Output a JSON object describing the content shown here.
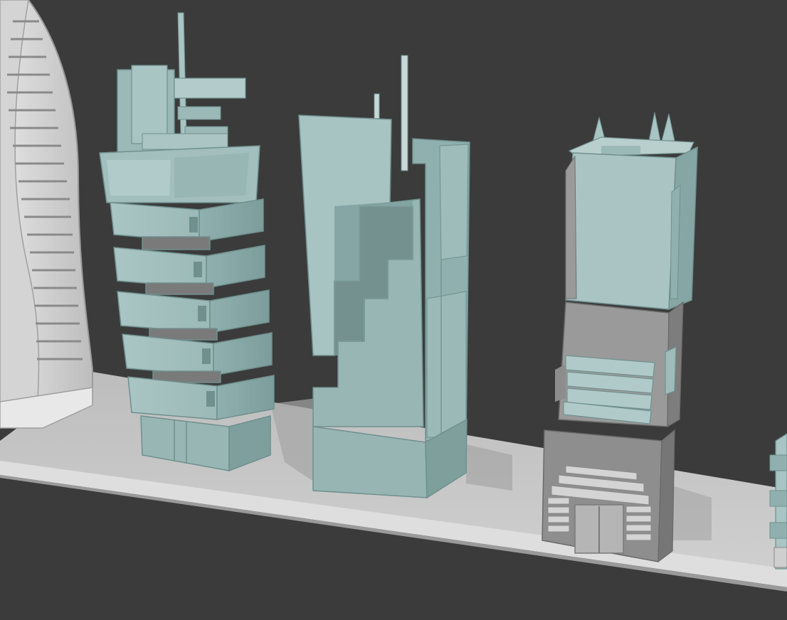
{
  "scene": {
    "colors": {
      "background": "#3b3b3b",
      "ground_top": "#c9c9c9",
      "ground_front": "#d9d9d9",
      "ground_shadow": "#8d8d8d",
      "teal_light": "#a8c4c3",
      "teal_mid": "#8fb0ae",
      "teal_dark": "#6f908e",
      "glass": "#7fa19f",
      "gray_light": "#cfcfcf",
      "gray_mid": "#9a9a9a",
      "gray_dark": "#6a6a6a",
      "edge": "#e6efee"
    },
    "objects": [
      "spiral-tower",
      "stacked-block-tower",
      "panel-tower",
      "block-top-tower",
      "partial-tower-right"
    ]
  }
}
